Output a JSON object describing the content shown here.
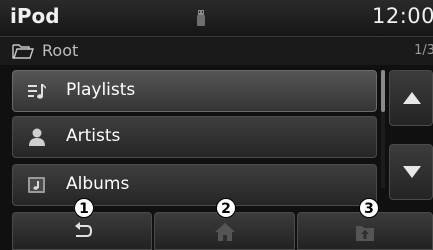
{
  "header": {
    "source": "iPod",
    "usb_icon": "usb-icon",
    "clock": "12:00"
  },
  "path": {
    "folder_icon": "folder-icon",
    "name": "Root",
    "page_indicator": "1/3"
  },
  "list": {
    "items": [
      {
        "label": "Playlists",
        "icon": "playlist-icon",
        "selected": true
      },
      {
        "label": "Artists",
        "icon": "person-icon",
        "selected": false
      },
      {
        "label": "Albums",
        "icon": "album-icon",
        "selected": false
      }
    ]
  },
  "scroll": {
    "up_icon": "arrow-up-icon",
    "down_icon": "arrow-down-icon",
    "position_fraction": 0.0
  },
  "bottom": {
    "buttons": [
      {
        "icon": "back-icon",
        "callout": "1"
      },
      {
        "icon": "home-icon",
        "callout": "2"
      },
      {
        "icon": "up-folder-icon",
        "callout": "3"
      }
    ]
  }
}
